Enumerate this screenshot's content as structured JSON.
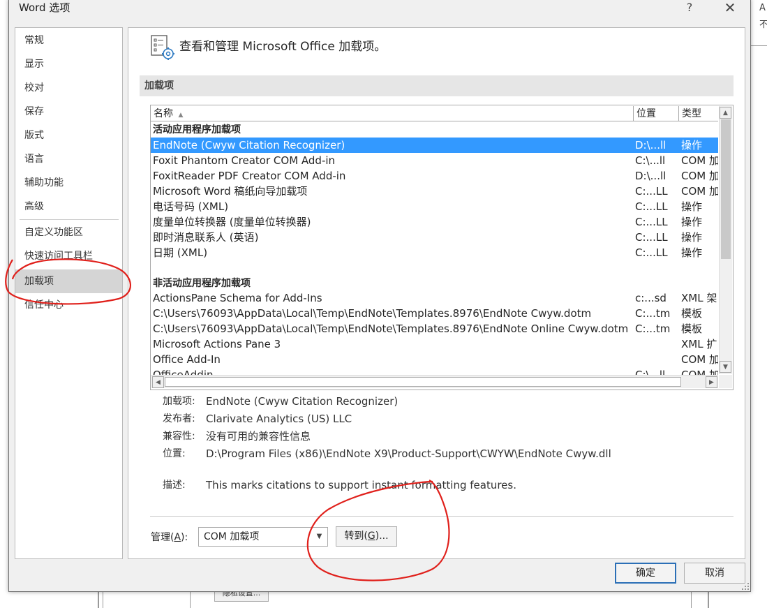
{
  "window": {
    "title": "Word 选项",
    "help": "?",
    "close": "✕"
  },
  "background": {
    "right_strip": [
      "A",
      "不"
    ],
    "button": "隐私设置..."
  },
  "nav": {
    "items": [
      "常规",
      "显示",
      "校对",
      "保存",
      "版式",
      "语言",
      "辅助功能",
      "高级",
      "自定义功能区",
      "快速访问工具栏",
      "加载项",
      "信任中心"
    ],
    "selected": "加载项"
  },
  "header": {
    "title": "查看和管理 Microsoft Office 加载项。",
    "icon": "addins-gear-icon"
  },
  "section": {
    "title": "加载项"
  },
  "list": {
    "columns": {
      "name": "名称",
      "location": "位置",
      "type": "类型"
    },
    "sort_indicator": "▲",
    "groups": [
      {
        "title": "活动应用程序加载项",
        "rows": [
          {
            "name": "EndNote (Cwyw Citation Recognizer)",
            "location": "D:\\...ll",
            "type": "操作"
          },
          {
            "name": "Foxit Phantom Creator COM Add-in",
            "location": "C:\\...ll",
            "type": "COM 加"
          },
          {
            "name": "FoxitReader PDF Creator COM Add-in",
            "location": "D:\\...ll",
            "type": "COM 加"
          },
          {
            "name": "Microsoft Word 稿纸向导加载项",
            "location": "C:...LL",
            "type": "COM 加"
          },
          {
            "name": "电话号码 (XML)",
            "location": "C:...LL",
            "type": "操作"
          },
          {
            "name": "度量单位转换器 (度量单位转换器)",
            "location": "C:...LL",
            "type": "操作"
          },
          {
            "name": "即时消息联系人 (英语)",
            "location": "C:...LL",
            "type": "操作"
          },
          {
            "name": "日期 (XML)",
            "location": "C:...LL",
            "type": "操作"
          }
        ]
      },
      {
        "title": "非活动应用程序加载项",
        "rows": [
          {
            "name": "ActionsPane Schema for Add-Ins",
            "location": "c:...sd",
            "type": "XML 架"
          },
          {
            "name": "C:\\Users\\76093\\AppData\\Local\\Temp\\EndNote\\Templates.8976\\EndNote Cwyw.dotm",
            "location": "C:...tm",
            "type": "模板"
          },
          {
            "name": "C:\\Users\\76093\\AppData\\Local\\Temp\\EndNote\\Templates.8976\\EndNote Online Cwyw.dotm",
            "location": "C:...tm",
            "type": "模板"
          },
          {
            "name": "Microsoft Actions Pane 3",
            "location": "",
            "type": "XML 扩"
          },
          {
            "name": "Office Add-In",
            "location": "",
            "type": "COM 加"
          },
          {
            "name": "OfficeAddin",
            "location": "C:\\...ll",
            "type": "COM 加"
          }
        ]
      }
    ],
    "selected_row": "EndNote (Cwyw Citation Recognizer)"
  },
  "details": {
    "addin_label": "加载项:",
    "addin_value": "EndNote (Cwyw Citation Recognizer)",
    "publisher_label": "发布者:",
    "publisher_value": "Clarivate Analytics (US) LLC",
    "compat_label": "兼容性:",
    "compat_value": "没有可用的兼容性信息",
    "location_label": "位置:",
    "location_value": "D:\\Program Files (x86)\\EndNote X9\\Product-Support\\CWYW\\EndNote Cwyw.dll",
    "desc_label": "描述:",
    "desc_value": "This marks citations to support instant formatting features."
  },
  "manage": {
    "label_pre": "管理(",
    "label_key": "A",
    "label_post": "):",
    "selected": "COM 加载项",
    "go_pre": "转到(",
    "go_key": "G",
    "go_post": ")..."
  },
  "footer": {
    "ok": "确定",
    "cancel": "取消"
  },
  "colors": {
    "selection": "#3399ff",
    "annotation": "#e0201b",
    "ok_border": "#2b6fb6"
  }
}
